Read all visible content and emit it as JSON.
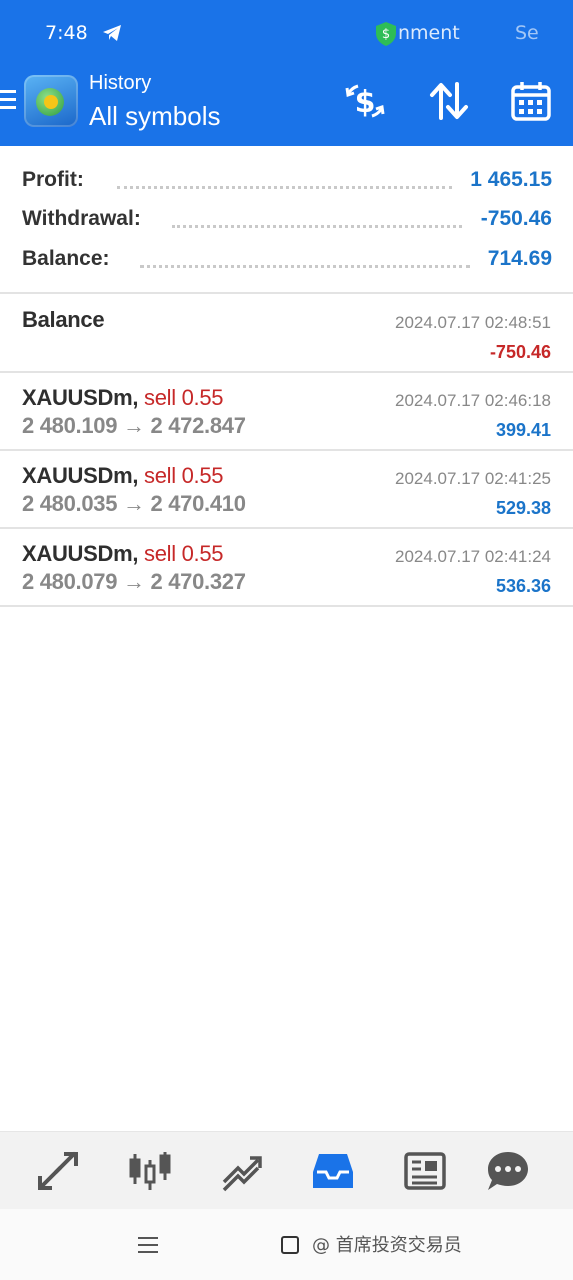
{
  "status_bar": {
    "time": "7:48",
    "notification_text": "nment",
    "right_text": "Se"
  },
  "app_bar": {
    "subtitle": "History",
    "title": "All symbols"
  },
  "summary": {
    "profit_label": "Profit:",
    "profit_value": "1 465.15",
    "withdrawal_label": "Withdrawal:",
    "withdrawal_value": "-750.46",
    "balance_label": "Balance:",
    "balance_value": "714.69"
  },
  "deals": [
    {
      "symbol": "Balance",
      "side": "",
      "prices": "",
      "time": "2024.07.17 02:48:51",
      "amount": "-750.46",
      "amount_sign": "neg"
    },
    {
      "symbol": "XAUUSDm",
      "side": "sell 0.55",
      "prices": "2 480.109 → 2 472.847",
      "time": "2024.07.17 02:46:18",
      "amount": "399.41",
      "amount_sign": "pos"
    },
    {
      "symbol": "XAUUSDm",
      "side": "sell 0.55",
      "prices": "2 480.035 → 2 470.410",
      "time": "2024.07.17 02:41:25",
      "amount": "529.38",
      "amount_sign": "pos"
    },
    {
      "symbol": "XAUUSDm",
      "side": "sell 0.55",
      "prices": "2 480.079 → 2 470.327",
      "time": "2024.07.17 02:41:24",
      "amount": "536.36",
      "amount_sign": "pos"
    }
  ],
  "bottom_nav": [
    {
      "icon": "quotes-icon",
      "active": false
    },
    {
      "icon": "chart-icon",
      "active": false
    },
    {
      "icon": "trade-icon",
      "active": false
    },
    {
      "icon": "history-icon",
      "active": true
    },
    {
      "icon": "news-icon",
      "active": false
    },
    {
      "icon": "chat-icon",
      "active": false
    }
  ],
  "system_bar": {
    "watermark": "@ 首席投资交易员"
  },
  "colors": {
    "header_blue": "#1a73e8",
    "positive_blue": "#1b74c9",
    "negative_red": "#c62828",
    "active_nav": "#1a73e8",
    "inactive_nav": "#555555"
  }
}
